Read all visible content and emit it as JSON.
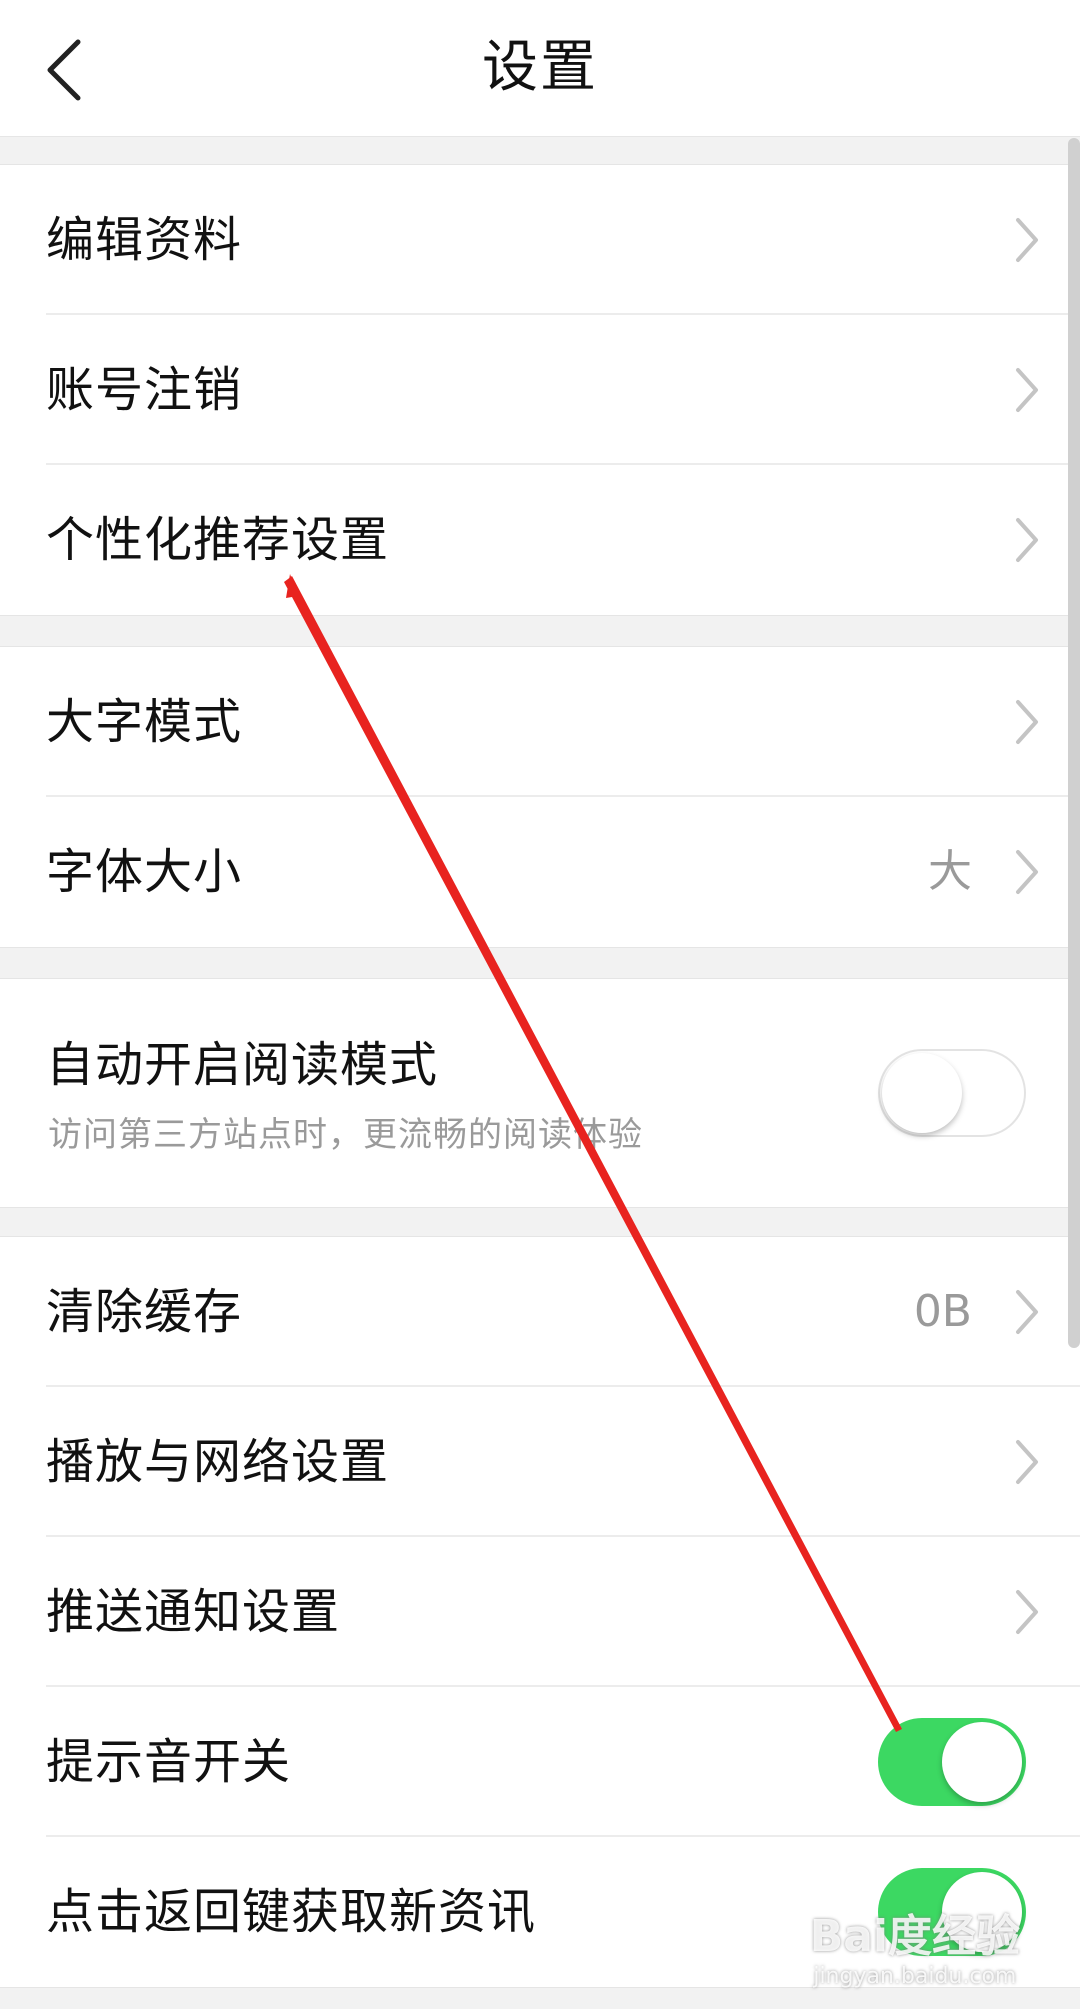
{
  "header": {
    "title": "设置",
    "back_icon": "chevron-left-icon"
  },
  "groups": [
    {
      "items": [
        {
          "label": "编辑资料"
        },
        {
          "label": "账号注销"
        },
        {
          "label": "个性化推荐设置"
        }
      ]
    },
    {
      "items": [
        {
          "label": "大字模式"
        },
        {
          "label": "字体大小",
          "value": "大"
        }
      ]
    },
    {
      "items": [
        {
          "label": "自动开启阅读模式",
          "subtitle": "访问第三方站点时，更流畅的阅读体验",
          "toggle": "off"
        }
      ]
    },
    {
      "items": [
        {
          "label": "清除缓存",
          "value": "0B"
        },
        {
          "label": "播放与网络设置"
        },
        {
          "label": "推送通知设置"
        },
        {
          "label": "提示音开关",
          "toggle": "on"
        },
        {
          "label": "点击返回键获取新资讯",
          "toggle": "on"
        }
      ]
    }
  ],
  "colors": {
    "toggle_on": "#3cd862",
    "annotation_arrow": "#e8231f"
  },
  "watermark": {
    "main": "Bai度经验",
    "sub": "jingyan.baidu.com"
  }
}
